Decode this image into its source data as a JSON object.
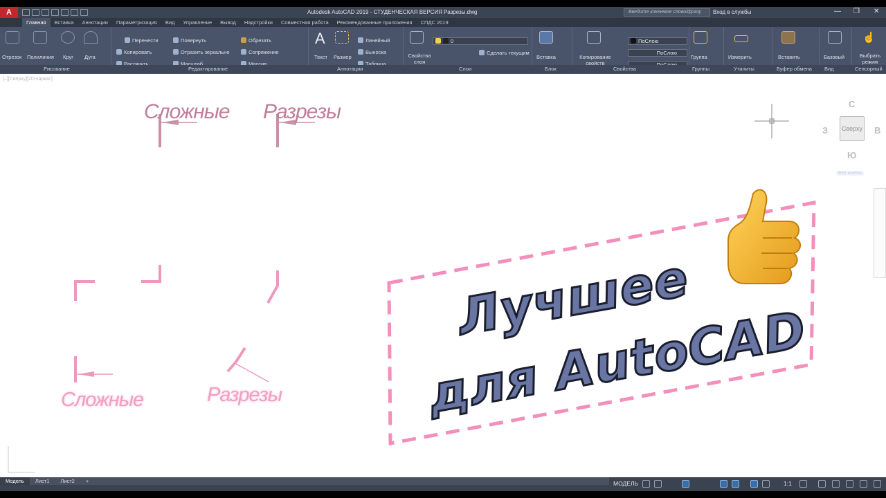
{
  "app": {
    "logo": "A",
    "title": "Autodesk AutoCAD 2019 - СТУДЕНЧЕСКАЯ ВЕРСИЯ    Разрезы.dwg",
    "search_placeholder": "Введите ключевое слово/фразу",
    "login": "Вход в службы"
  },
  "tabs": [
    "Главная",
    "Вставка",
    "Аннотации",
    "Параметризация",
    "Вид",
    "Управление",
    "Вывод",
    "Надстройки",
    "Совместная работа",
    "Рекомендованные приложения",
    "СПДС 2019"
  ],
  "ribbon": {
    "draw": [
      "Отрезок",
      "Полилиния",
      "Круг",
      "Дуга"
    ],
    "modify": [
      "Перенести",
      "Повернуть",
      "Обрезать",
      "Копировать",
      "Отразить зеркально",
      "Сопряжение",
      "Растянуть",
      "Масштаб",
      "Массив"
    ],
    "annotation": [
      "Текст",
      "Размер",
      "Линейный",
      "Выноска",
      "Таблица"
    ],
    "layers": {
      "props": "Свойства слоя",
      "current_layer": "0",
      "make_current": "Сделать текущим"
    },
    "block": {
      "insert": "Вставка"
    },
    "properties": {
      "copy": "Копирование свойств",
      "bylayer": "ПоСлою"
    },
    "groups": {
      "group": "Группа"
    },
    "utilities": {
      "measure": "Измерить"
    },
    "clipboard": {
      "paste": "Вставить"
    },
    "view": {
      "base": "Базовый"
    },
    "touch": {
      "select_mode": "Выбрать режим"
    },
    "panel_titles": [
      "Рисование",
      "Редактирование",
      "Аннотации",
      "Слои",
      "Блок",
      "Свойства",
      "Группы",
      "Утилиты",
      "Буфер обмена",
      "Вид",
      "Сенсорный"
    ]
  },
  "viewport": {
    "label": "[–][Сверху][2D-каркас]",
    "texts": [
      "Сложные",
      "Разрезы",
      "Сложные",
      "Разрезы"
    ]
  },
  "viewcube": {
    "n": "С",
    "s": "Ю",
    "w": "З",
    "e": "В",
    "face": "Сверху",
    "wcs": "Без имени"
  },
  "banner": {
    "line1": "Лучшее",
    "line2": "для AutoCAD"
  },
  "layout_tabs": [
    "Модель",
    "Лист1",
    "Лист2"
  ],
  "status": {
    "model": "МОДЕЛЬ",
    "scale": "1:1"
  }
}
